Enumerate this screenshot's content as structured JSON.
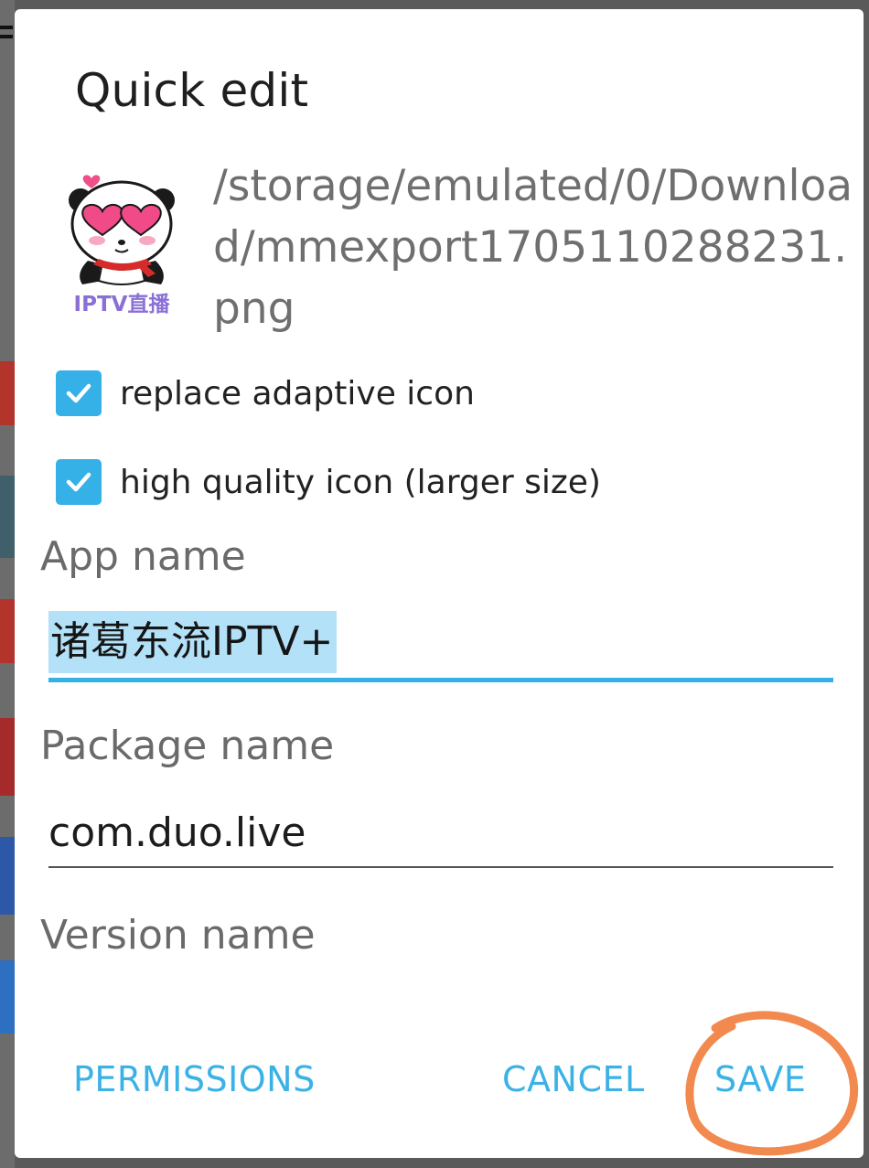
{
  "dialog": {
    "title": "Quick edit",
    "file_path": "/storage/emulated/0/Download/mmexport1705110288231.png",
    "icon_caption": "IPTV直播",
    "checkboxes": [
      {
        "label": "replace adaptive icon",
        "checked": true
      },
      {
        "label": "high quality icon (larger size)",
        "checked": true
      }
    ],
    "app_name": {
      "label": "App name",
      "value": "诸葛东流IPTV+"
    },
    "package_name": {
      "label": "Package name",
      "value": "com.duo.live"
    },
    "version_name": {
      "label": "Version name",
      "value": ""
    },
    "buttons": {
      "permissions": "PERMISSIONS",
      "cancel": "CANCEL",
      "save": "SAVE"
    }
  },
  "colors": {
    "accent": "#36b1e8",
    "annotation": "#f2894f"
  }
}
